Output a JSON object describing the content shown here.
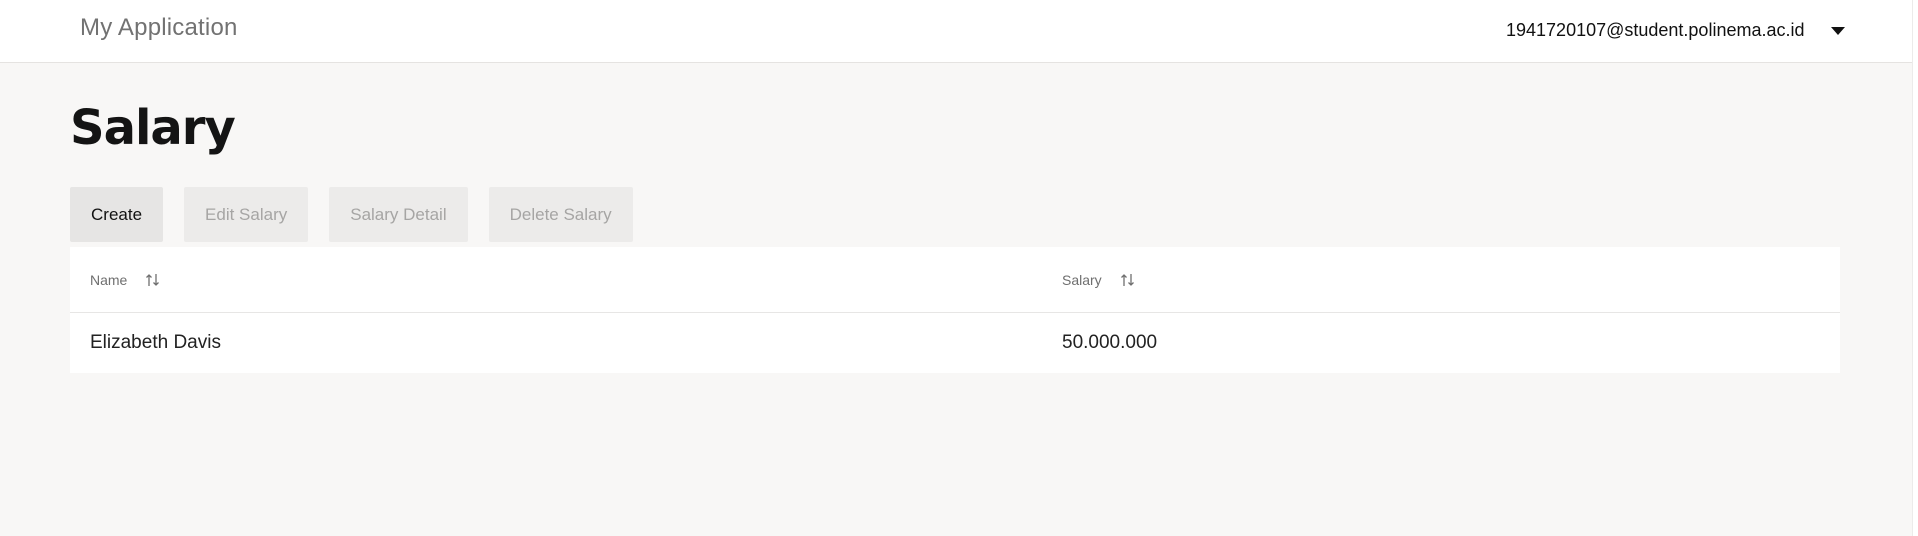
{
  "header": {
    "app_title": "My Application",
    "user_email": "1941720107@student.polinema.ac.id",
    "menu_icon": "chevron-down-icon"
  },
  "page": {
    "title": "Salary"
  },
  "toolbar": {
    "create_label": "Create",
    "edit_label": "Edit Salary",
    "detail_label": "Salary Detail",
    "delete_label": "Delete Salary"
  },
  "table": {
    "columns": [
      {
        "label": "Name",
        "sort_icon": "sort-icon"
      },
      {
        "label": "Salary",
        "sort_icon": "sort-icon"
      }
    ],
    "rows": [
      {
        "name": "Elizabeth Davis",
        "salary": "50.000.000"
      }
    ]
  },
  "colors": {
    "page_background": "#f8f7f6",
    "header_background": "#ffffff",
    "button_background": "#e6e5e4",
    "disabled_text": "#a6a5a4"
  }
}
